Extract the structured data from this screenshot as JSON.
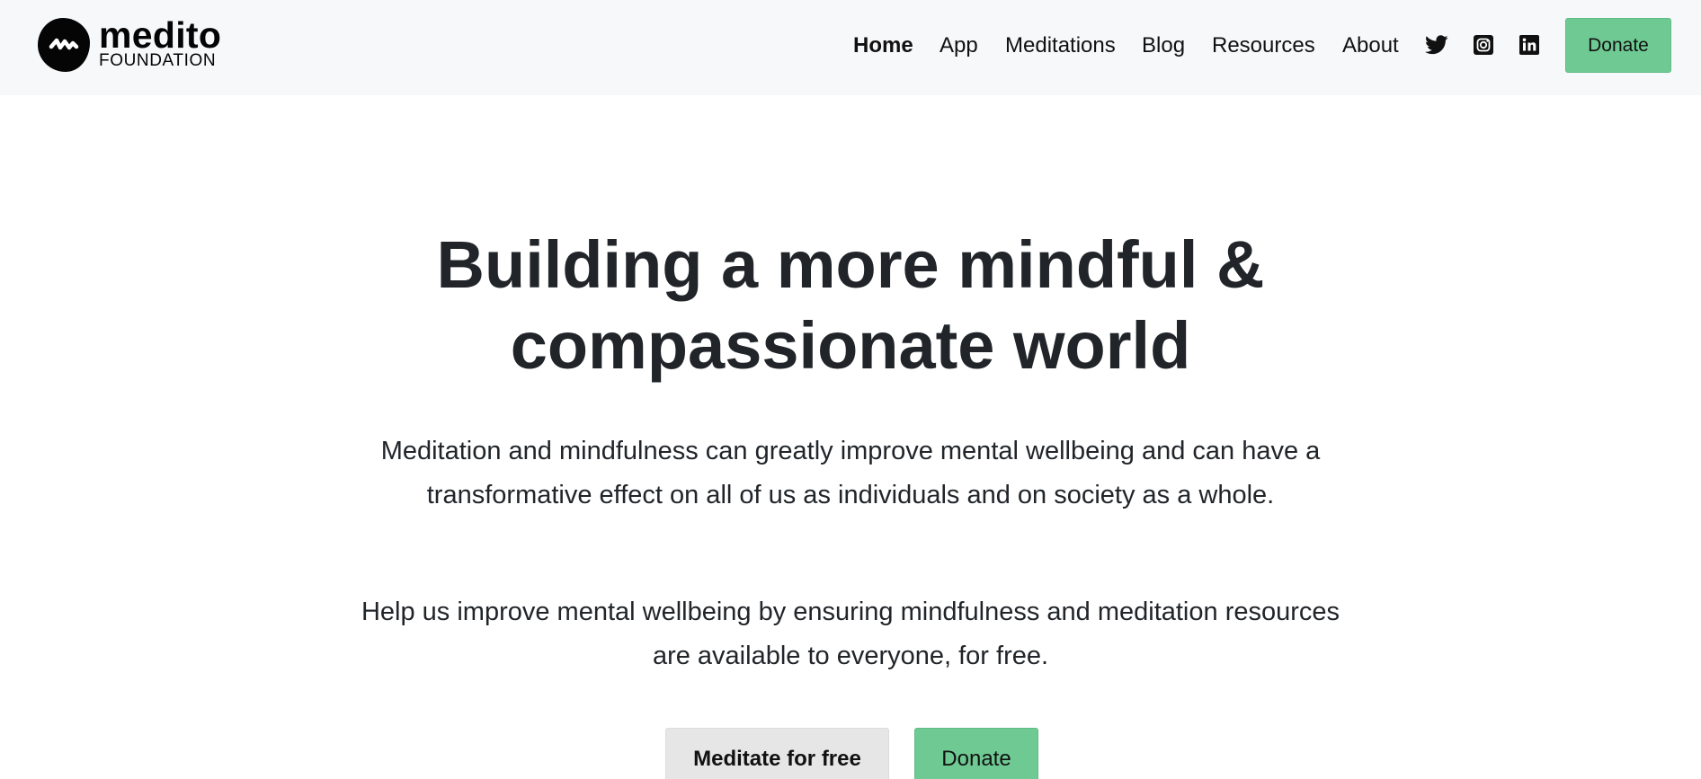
{
  "brand": {
    "name": "medito",
    "subtitle": "FOUNDATION",
    "logo_icon": "medito-wave-logo-icon"
  },
  "nav": {
    "items": [
      {
        "label": "Home",
        "active": true
      },
      {
        "label": "App",
        "active": false
      },
      {
        "label": "Meditations",
        "active": false
      },
      {
        "label": "Blog",
        "active": false
      },
      {
        "label": "Resources",
        "active": false
      },
      {
        "label": "About",
        "active": false
      }
    ],
    "social_icons": [
      "twitter-icon",
      "instagram-icon",
      "linkedin-icon"
    ],
    "donate_label": "Donate"
  },
  "hero": {
    "title_line1": "Building a more mindful &",
    "title_line2": "compassionate world",
    "paragraph1": "Meditation and mindfulness can greatly improve mental wellbeing and can have a transformative effect on all of us as individuals and on society as a whole.",
    "paragraph2": "Help us improve mental wellbeing by ensuring mindfulness and meditation resources are available to everyone, for free.",
    "primary_button": "Meditate for free",
    "secondary_button": "Donate"
  },
  "colors": {
    "navbar_bg": "#f7f8fa",
    "accent_green": "#6fc993",
    "button_grey": "#e6e6e6",
    "text_dark": "#212529"
  }
}
